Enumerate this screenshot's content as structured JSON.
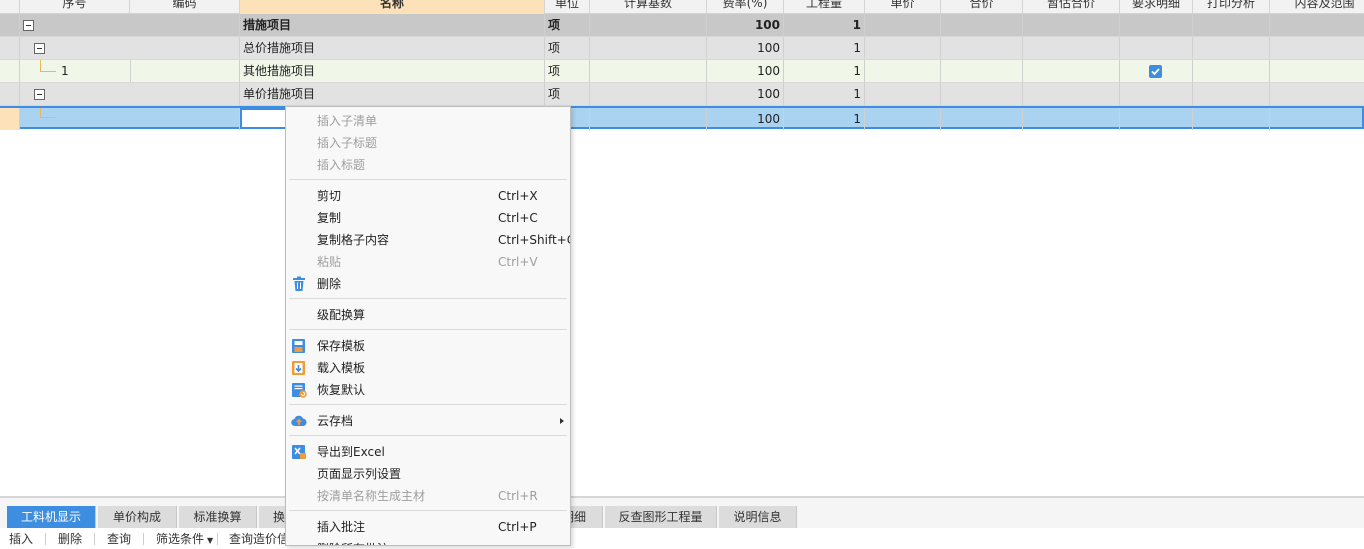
{
  "grid": {
    "headers": [
      "序号",
      "编码",
      "名称",
      "单位",
      "计算基数",
      "费率(%)",
      "工程量",
      "单价",
      "合价",
      "暂估合价",
      "要求明细",
      "打印分析",
      "内容及范围"
    ],
    "rows": [
      {
        "seq": "",
        "code": "",
        "name": "措施项目",
        "unit": "项",
        "rate": "100",
        "qty": "1"
      },
      {
        "seq": "",
        "code": "",
        "name": "总价措施项目",
        "unit": "项",
        "rate": "100",
        "qty": "1"
      },
      {
        "seq": "1",
        "code": "",
        "name": "其他措施项目",
        "unit": "项",
        "rate": "100",
        "qty": "1",
        "require_detail": true
      },
      {
        "seq": "",
        "code": "",
        "name": "单价措施项目",
        "unit": "项",
        "rate": "100",
        "qty": "1"
      },
      {
        "seq": "",
        "code": "",
        "name": "",
        "unit": "",
        "rate": "100",
        "qty": "1"
      }
    ]
  },
  "context_menu": {
    "items": [
      {
        "label": "插入子清单",
        "shortcut": "",
        "disabled": true
      },
      {
        "label": "插入子标题",
        "shortcut": "",
        "disabled": true
      },
      {
        "label": "插入标题",
        "shortcut": "",
        "disabled": true
      },
      {
        "label": "剪切",
        "shortcut": "Ctrl+X",
        "disabled": false
      },
      {
        "label": "复制",
        "shortcut": "Ctrl+C",
        "disabled": false
      },
      {
        "label": "复制格子内容",
        "shortcut": "Ctrl+Shift+C",
        "disabled": false
      },
      {
        "label": "粘贴",
        "shortcut": "Ctrl+V",
        "disabled": true
      },
      {
        "label": "删除",
        "shortcut": "",
        "disabled": false,
        "icon": "trash-icon"
      },
      {
        "label": "级配换算",
        "shortcut": "",
        "disabled": false
      },
      {
        "label": "保存模板",
        "shortcut": "",
        "disabled": false,
        "icon": "save-template-icon"
      },
      {
        "label": "载入模板",
        "shortcut": "",
        "disabled": false,
        "icon": "load-template-icon"
      },
      {
        "label": "恢复默认",
        "shortcut": "",
        "disabled": false,
        "icon": "restore-default-icon"
      },
      {
        "label": "云存档",
        "shortcut": "",
        "disabled": false,
        "icon": "cloud-upload-icon",
        "submenu": true
      },
      {
        "label": "导出到Excel",
        "shortcut": "",
        "disabled": false,
        "icon": "excel-export-icon"
      },
      {
        "label": "页面显示列设置",
        "shortcut": "",
        "disabled": false
      },
      {
        "label": "按清单名称生成主材",
        "shortcut": "Ctrl+R",
        "disabled": true
      },
      {
        "label": "插入批注",
        "shortcut": "Ctrl+P",
        "disabled": false
      },
      {
        "label": "删除所有批注",
        "shortcut": "",
        "disabled": false
      }
    ]
  },
  "bottom_tabs": [
    "工料机显示",
    "单价构成",
    "标准换算",
    "换",
    "明细",
    "反查图形工程量",
    "说明信息"
  ],
  "toolbar": [
    "插入",
    "删除",
    "查询",
    "筛选条件",
    "查询造价信"
  ],
  "colors": {
    "accent": "#3d8de0",
    "header_active": "#fde1b8",
    "selected_row": "#a9d3f1"
  }
}
